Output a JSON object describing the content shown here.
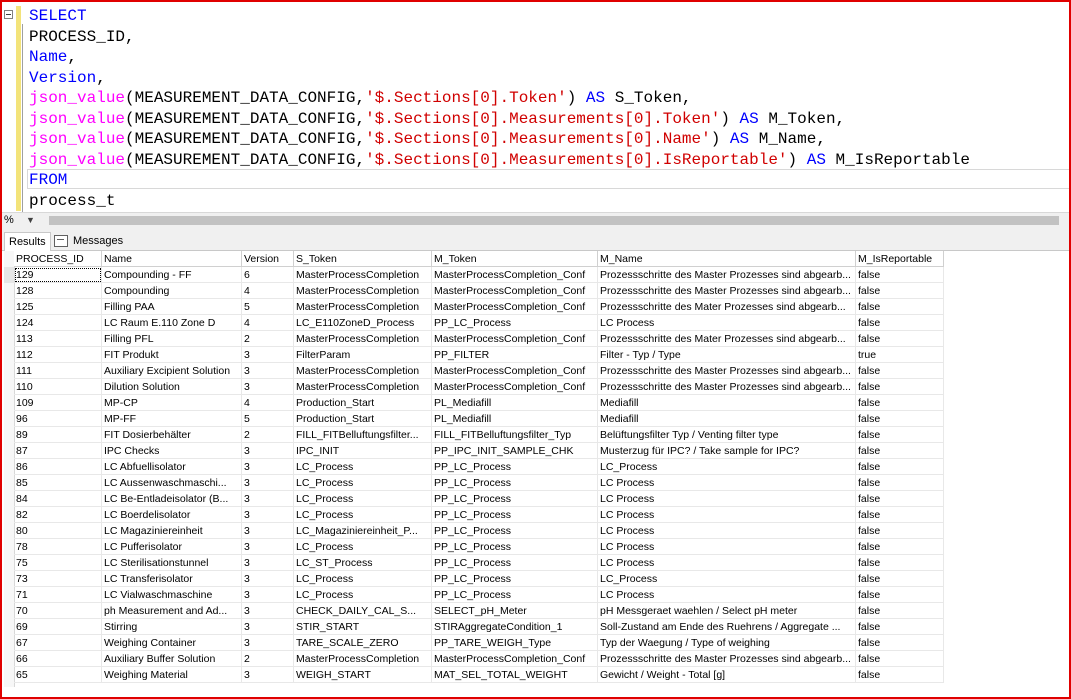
{
  "editor": {
    "lines": [
      {
        "segments": [
          {
            "t": "SELECT",
            "c": "kw"
          }
        ]
      },
      {
        "segments": [
          {
            "t": "PROCESS_ID,",
            "c": ""
          }
        ]
      },
      {
        "segments": [
          {
            "t": "Name",
            "c": "kw"
          },
          {
            "t": ",",
            "c": ""
          }
        ]
      },
      {
        "segments": [
          {
            "t": "Version",
            "c": "kw"
          },
          {
            "t": ",",
            "c": ""
          }
        ]
      },
      {
        "segments": [
          {
            "t": "json_value",
            "c": "fn"
          },
          {
            "t": "(MEASUREMENT_DATA_CONFIG,",
            "c": ""
          },
          {
            "t": "'$.Sections[0].Token'",
            "c": "str"
          },
          {
            "t": ") ",
            "c": ""
          },
          {
            "t": "AS",
            "c": "kw"
          },
          {
            "t": " S_Token,",
            "c": ""
          }
        ]
      },
      {
        "segments": [
          {
            "t": "json_value",
            "c": "fn"
          },
          {
            "t": "(MEASUREMENT_DATA_CONFIG,",
            "c": ""
          },
          {
            "t": "'$.Sections[0].Measurements[0].Token'",
            "c": "str"
          },
          {
            "t": ") ",
            "c": ""
          },
          {
            "t": "AS",
            "c": "kw"
          },
          {
            "t": " M_Token,",
            "c": ""
          }
        ]
      },
      {
        "segments": [
          {
            "t": "json_value",
            "c": "fn"
          },
          {
            "t": "(MEASUREMENT_DATA_CONFIG,",
            "c": ""
          },
          {
            "t": "'$.Sections[0].Measurements[0].Name'",
            "c": "str"
          },
          {
            "t": ") ",
            "c": ""
          },
          {
            "t": "AS",
            "c": "kw"
          },
          {
            "t": " M_Name,",
            "c": ""
          }
        ]
      },
      {
        "segments": [
          {
            "t": "json_value",
            "c": "fn"
          },
          {
            "t": "(MEASUREMENT_DATA_CONFIG,",
            "c": ""
          },
          {
            "t": "'$.Sections[0].Measurements[0].IsReportable'",
            "c": "str"
          },
          {
            "t": ") ",
            "c": ""
          },
          {
            "t": "AS",
            "c": "kw"
          },
          {
            "t": " M_IsReportable",
            "c": ""
          }
        ]
      },
      {
        "segments": [
          {
            "t": "FROM",
            "c": "kw"
          }
        ]
      },
      {
        "segments": [
          {
            "t": "process_t",
            "c": ""
          }
        ]
      }
    ]
  },
  "zoom": {
    "label": "%",
    "arrow": "▼"
  },
  "tabs": [
    {
      "label": "Results",
      "active": true
    },
    {
      "label": "Messages",
      "active": false
    }
  ],
  "grid": {
    "columns": [
      "PROCESS_ID",
      "Name",
      "Version",
      "S_Token",
      "M_Token",
      "M_Name",
      "M_IsReportable"
    ],
    "rows": [
      [
        "129",
        "Compounding - FF",
        "6",
        "MasterProcessCompletion",
        "MasterProcessCompletion_Conf",
        "Prozessschritte des Master Prozesses sind abgearb...",
        "false"
      ],
      [
        "128",
        "Compounding",
        "4",
        "MasterProcessCompletion",
        "MasterProcessCompletion_Conf",
        "Prozessschritte des Master Prozesses sind abgearb...",
        "false"
      ],
      [
        "125",
        "Filling PAA",
        "5",
        "MasterProcessCompletion",
        "MasterProcessCompletion_Conf",
        "Prozessschritte des Mater Prozesses sind abgearb...",
        "false"
      ],
      [
        "124",
        "LC Raum E.110 Zone D",
        "4",
        "LC_E110ZoneD_Process",
        "PP_LC_Process",
        "LC Process",
        "false"
      ],
      [
        "113",
        "Filling PFL",
        "2",
        "MasterProcessCompletion",
        "MasterProcessCompletion_Conf",
        "Prozessschritte des Mater Prozesses sind abgearb...",
        "false"
      ],
      [
        "112",
        "FIT Produkt",
        "3",
        "FilterParam",
        "PP_FILTER",
        "Filter - Typ / Type",
        "true"
      ],
      [
        "111",
        "Auxiliary Excipient Solution",
        "3",
        "MasterProcessCompletion",
        "MasterProcessCompletion_Conf",
        "Prozessschritte des Master Prozesses sind abgearb...",
        "false"
      ],
      [
        "110",
        "Dilution Solution",
        "3",
        "MasterProcessCompletion",
        "MasterProcessCompletion_Conf",
        "Prozessschritte des Master Prozesses sind abgearb...",
        "false"
      ],
      [
        "109",
        "MP-CP",
        "4",
        "Production_Start",
        "PL_Mediafill",
        "Mediafill",
        "false"
      ],
      [
        "96",
        "MP-FF",
        "5",
        "Production_Start",
        "PL_Mediafill",
        "Mediafill",
        "false"
      ],
      [
        "89",
        "FIT Dosierbehälter",
        "2",
        "FILL_FITBelluftungsfilter...",
        "FILL_FITBelluftungsfilter_Typ",
        "Belüftungsfilter Typ / Venting filter type",
        "false"
      ],
      [
        "87",
        "IPC Checks",
        "3",
        "IPC_INIT",
        "PP_IPC_INIT_SAMPLE_CHK",
        "Musterzug für IPC? / Take sample for IPC?",
        "false"
      ],
      [
        "86",
        "LC Abfuellisolator",
        "3",
        "LC_Process",
        "PP_LC_Process",
        "LC_Process",
        "false"
      ],
      [
        "85",
        "LC Aussenwaschmaschi...",
        "3",
        "LC_Process",
        "PP_LC_Process",
        "LC Process",
        "false"
      ],
      [
        "84",
        "LC Be-Entladeisolator (B...",
        "3",
        "LC_Process",
        "PP_LC_Process",
        "LC Process",
        "false"
      ],
      [
        "82",
        "LC Boerdelisolator",
        "3",
        "LC_Process",
        "PP_LC_Process",
        "LC Process",
        "false"
      ],
      [
        "80",
        "LC Magaziniereinheit",
        "3",
        "LC_Magaziniereinheit_P...",
        "PP_LC_Process",
        "LC Process",
        "false"
      ],
      [
        "78",
        "LC Pufferisolator",
        "3",
        "LC_Process",
        "PP_LC_Process",
        "LC Process",
        "false"
      ],
      [
        "75",
        "LC Sterilisationstunnel",
        "3",
        "LC_ST_Process",
        "PP_LC_Process",
        "LC Process",
        "false"
      ],
      [
        "73",
        "LC Transferisolator",
        "3",
        "LC_Process",
        "PP_LC_Process",
        "LC_Process",
        "false"
      ],
      [
        "71",
        "LC Vialwaschmaschine",
        "3",
        "LC_Process",
        "PP_LC_Process",
        "LC Process",
        "false"
      ],
      [
        "70",
        "ph Measurement and Ad...",
        "3",
        "CHECK_DAILY_CAL_S...",
        "SELECT_pH_Meter",
        "pH Messgeraet waehlen / Select pH meter",
        "false"
      ],
      [
        "69",
        "Stirring",
        "3",
        "STIR_START",
        "STIRAggregateCondition_1",
        "Soll-Zustand am Ende des Ruehrens / Aggregate ...",
        "false"
      ],
      [
        "67",
        "Weighing Container",
        "3",
        "TARE_SCALE_ZERO",
        "PP_TARE_WEIGH_Type",
        "Typ der Waegung / Type of weighing",
        "false"
      ],
      [
        "66",
        "Auxiliary Buffer Solution",
        "2",
        "MasterProcessCompletion",
        "MasterProcessCompletion_Conf",
        "Prozessschritte des Master Prozesses sind abgearb...",
        "false"
      ],
      [
        "65",
        "Weighing Material",
        "3",
        "WEIGH_START",
        "MAT_SEL_TOTAL_WEIGHT",
        "Gewicht / Weight - Total [g]",
        "false"
      ]
    ]
  },
  "colors": {
    "frame": "#e00000",
    "keyword": "#0000ff",
    "function": "#ff00ff",
    "string": "#d00000"
  }
}
